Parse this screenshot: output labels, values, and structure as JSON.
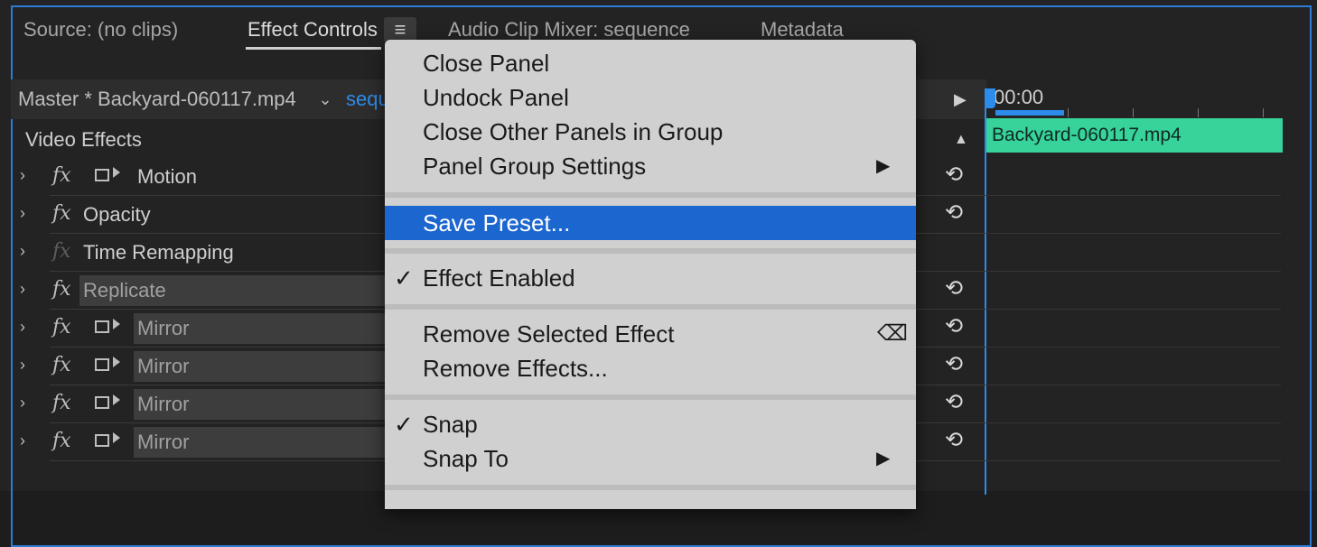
{
  "tabs": {
    "source": "Source: (no clips)",
    "effect_controls": "Effect Controls",
    "audio_clip_mixer": "Audio Clip Mixer: sequence",
    "metadata": "Metadata"
  },
  "panel_menu_icon": "hamburger-icon",
  "header": {
    "master": "Master * Backyard-060117.mp4",
    "sequence": "sequ",
    "timecode": "00:00"
  },
  "timeline": {
    "clip_name": "Backyard-060117.mp4"
  },
  "video_effects_label": "Video Effects",
  "effects": [
    {
      "name": "Motion",
      "fx_enabled": true,
      "transform": true,
      "reset": true,
      "selected": false
    },
    {
      "name": "Opacity",
      "fx_enabled": true,
      "transform": false,
      "reset": true,
      "selected": false
    },
    {
      "name": "Time Remapping",
      "fx_enabled": false,
      "transform": false,
      "reset": false,
      "selected": false
    },
    {
      "name": "Replicate",
      "fx_enabled": true,
      "transform": false,
      "reset": true,
      "selected": true
    },
    {
      "name": "Mirror",
      "fx_enabled": true,
      "transform": true,
      "reset": true,
      "selected": true
    },
    {
      "name": "Mirror",
      "fx_enabled": true,
      "transform": true,
      "reset": true,
      "selected": true
    },
    {
      "name": "Mirror",
      "fx_enabled": true,
      "transform": true,
      "reset": true,
      "selected": true
    },
    {
      "name": "Mirror",
      "fx_enabled": true,
      "transform": true,
      "reset": true,
      "selected": true
    }
  ],
  "context_menu": {
    "close_panel": "Close Panel",
    "undock_panel": "Undock Panel",
    "close_other_panels": "Close Other Panels in Group",
    "panel_group_settings": "Panel Group Settings",
    "save_preset": "Save Preset...",
    "effect_enabled": "Effect Enabled",
    "remove_selected_effect": "Remove Selected Effect",
    "remove_effects": "Remove Effects...",
    "snap": "Snap",
    "snap_to": "Snap To",
    "checkmark": "✓",
    "submenu_arrow": "▶",
    "delete_key": "⌫"
  },
  "colors": {
    "accent": "#2d8ceb",
    "clip": "#37d39a",
    "menu_highlight": "#1b66cf",
    "panel_bg": "#232323"
  }
}
